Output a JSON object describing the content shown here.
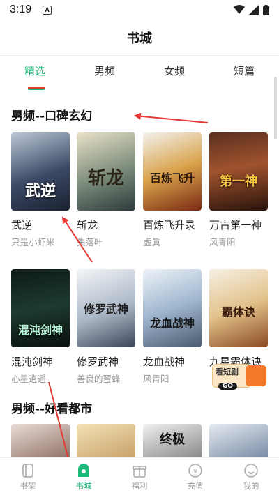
{
  "status_bar": {
    "time": "3:19",
    "notification_letter": "A"
  },
  "header": {
    "title": "书城"
  },
  "tabs": [
    {
      "label": "精选",
      "active": true
    },
    {
      "label": "男频"
    },
    {
      "label": "女频"
    },
    {
      "label": "短篇"
    }
  ],
  "sections": [
    {
      "title": "男频--口碑玄幻",
      "books": [
        {
          "name": "武逆",
          "author": "只是小虾米",
          "cover_text": "武逆"
        },
        {
          "name": "斩龙",
          "author": "失落叶",
          "cover_text": "斩龙"
        },
        {
          "name": "百炼飞升录",
          "author": "虚眞",
          "cover_text": "百炼飞升"
        },
        {
          "name": "万古第一神",
          "author": "风青阳",
          "cover_text": "第一神"
        },
        {
          "name": "混沌剑神",
          "author": "心星逍遥",
          "cover_text": "混沌剑神"
        },
        {
          "name": "修罗武神",
          "author": "善良的蜜蜂",
          "cover_text": "修罗武神"
        },
        {
          "name": "龙血战神",
          "author": "风青阳",
          "cover_text": "龙血战神"
        },
        {
          "name": "九星霸体诀",
          "author": "",
          "cover_text": "霸体诀"
        }
      ]
    },
    {
      "title": "男频--好看都市",
      "books": [
        {
          "name": "",
          "author": "",
          "cover_text": ""
        },
        {
          "name": "",
          "author": "",
          "cover_text": ""
        },
        {
          "name": "",
          "author": "",
          "cover_text": "终极"
        },
        {
          "name": "",
          "author": "",
          "cover_text": ""
        }
      ]
    }
  ],
  "promo": {
    "label": "看短剧",
    "go": "GO"
  },
  "bottom_nav": [
    {
      "label": "书架",
      "icon": "bookshelf-icon"
    },
    {
      "label": "书城",
      "icon": "bookstore-icon",
      "active": true
    },
    {
      "label": "福利",
      "icon": "gift-icon"
    },
    {
      "label": "充值",
      "icon": "coin-icon"
    },
    {
      "label": "我的",
      "icon": "profile-icon"
    }
  ],
  "colors": {
    "accent": "#1fb87a",
    "annotation_arrow": "#e53935"
  }
}
